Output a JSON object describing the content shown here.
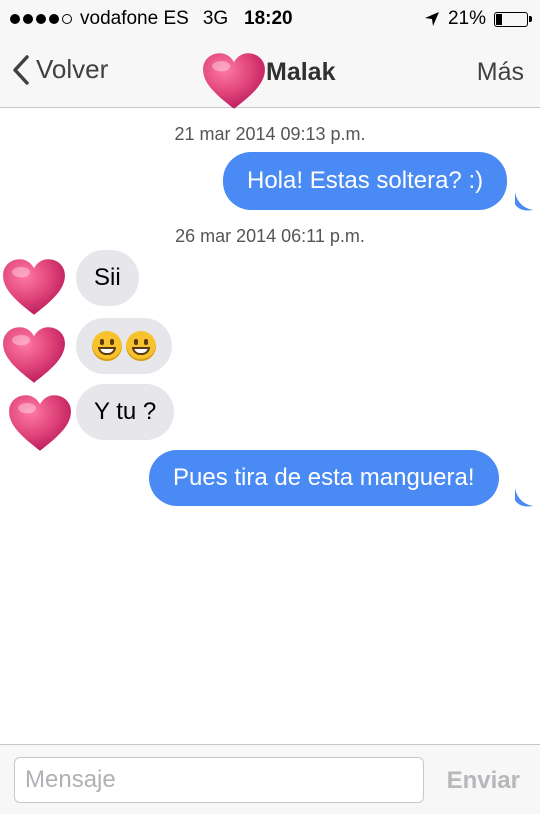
{
  "status_bar": {
    "carrier": "vodafone ES",
    "network": "3G",
    "time": "18:20",
    "battery": "21%",
    "battery_level": 0.21,
    "signal_bars": 4
  },
  "nav": {
    "back_label": "Volver",
    "contact_name": "Malak",
    "more_label": "Más"
  },
  "messages": {
    "ts1": "21 mar 2014 09:13 p.m.",
    "m1": "Hola! Estas soltera? :)",
    "ts2": "26 mar 2014 06:11 p.m.",
    "m2": "Sii",
    "m4": "Y tu ?",
    "m5": "Pues tira de esta manguera!"
  },
  "composer": {
    "placeholder": "Mensaje",
    "send_label": "Enviar"
  },
  "colors": {
    "outgoing_bubble": "#4a8af4",
    "incoming_bubble": "#e6e6eb",
    "avatar_heart": "#e0457a"
  }
}
